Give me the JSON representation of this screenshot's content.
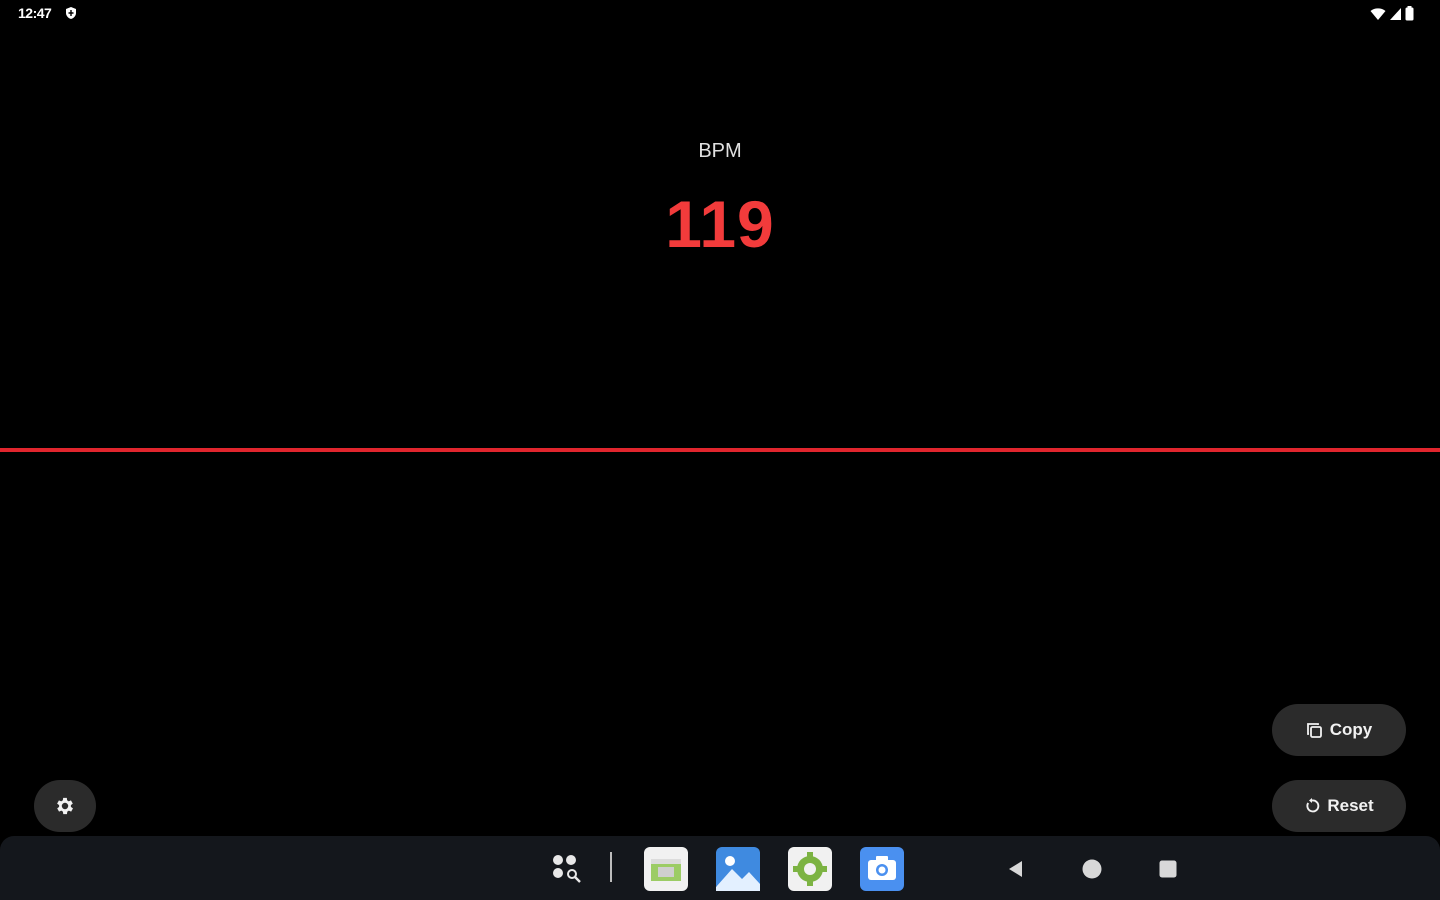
{
  "status_bar": {
    "time": "12:47",
    "notification_icon": "shield-icon",
    "right_icons": [
      "wifi-icon",
      "signal-icon",
      "battery-icon"
    ]
  },
  "main": {
    "label": "BPM",
    "value": "119",
    "accent_color": "#f23b3b",
    "line_color": "#e0252d"
  },
  "buttons": {
    "copy_label": "Copy",
    "copy_icon": "copy-icon",
    "reset_label": "Reset",
    "reset_icon": "reset-icon",
    "settings_icon": "gear-icon"
  },
  "taskbar": {
    "apps": [
      "all-apps-search",
      "sheets-app",
      "gallery-app",
      "android-settings-app",
      "camera-app"
    ],
    "nav": [
      "back",
      "home",
      "recents"
    ]
  }
}
